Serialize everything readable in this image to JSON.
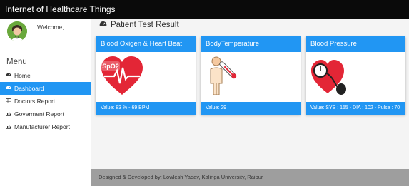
{
  "app": {
    "title": "Internet of Healthcare Things"
  },
  "sidebar": {
    "welcome": "Welcome,",
    "menu_title": "Menu",
    "items": [
      {
        "label": "Home",
        "icon": "dashboard-icon",
        "active": false
      },
      {
        "label": "Dashboard",
        "icon": "dashboard-icon",
        "active": true
      },
      {
        "label": "Doctors Report",
        "icon": "table-icon",
        "active": false
      },
      {
        "label": "Goverment Report",
        "icon": "bar-chart-icon",
        "active": false
      },
      {
        "label": "Manufacturer Report",
        "icon": "bar-chart-icon",
        "active": false
      }
    ]
  },
  "main": {
    "title": "Patient Test Result",
    "title_icon": "dashboard-icon",
    "cards": [
      {
        "title": "Blood Oxigen & Heart Beat",
        "value": "Value: 83 % - 69 BPM",
        "image": "spo2-heart-icon",
        "image_text": "SpO2"
      },
      {
        "title": "BodyTemperature",
        "value": "Value: 29 '",
        "image": "thermometer-person-icon"
      },
      {
        "title": "Blood Pressure",
        "value": "Value: SYS : 155 - DIA : 102 - Pulse : 70",
        "image": "blood-pressure-heart-icon"
      }
    ]
  },
  "footer": {
    "text": "Designed & Developed by: Lowlesh Yadav, Kalinga University, Raipur"
  },
  "colors": {
    "topbar": "#0a0a0a",
    "accent": "#2196f3",
    "footer": "#9e9e9e",
    "heart": "#e32636"
  }
}
